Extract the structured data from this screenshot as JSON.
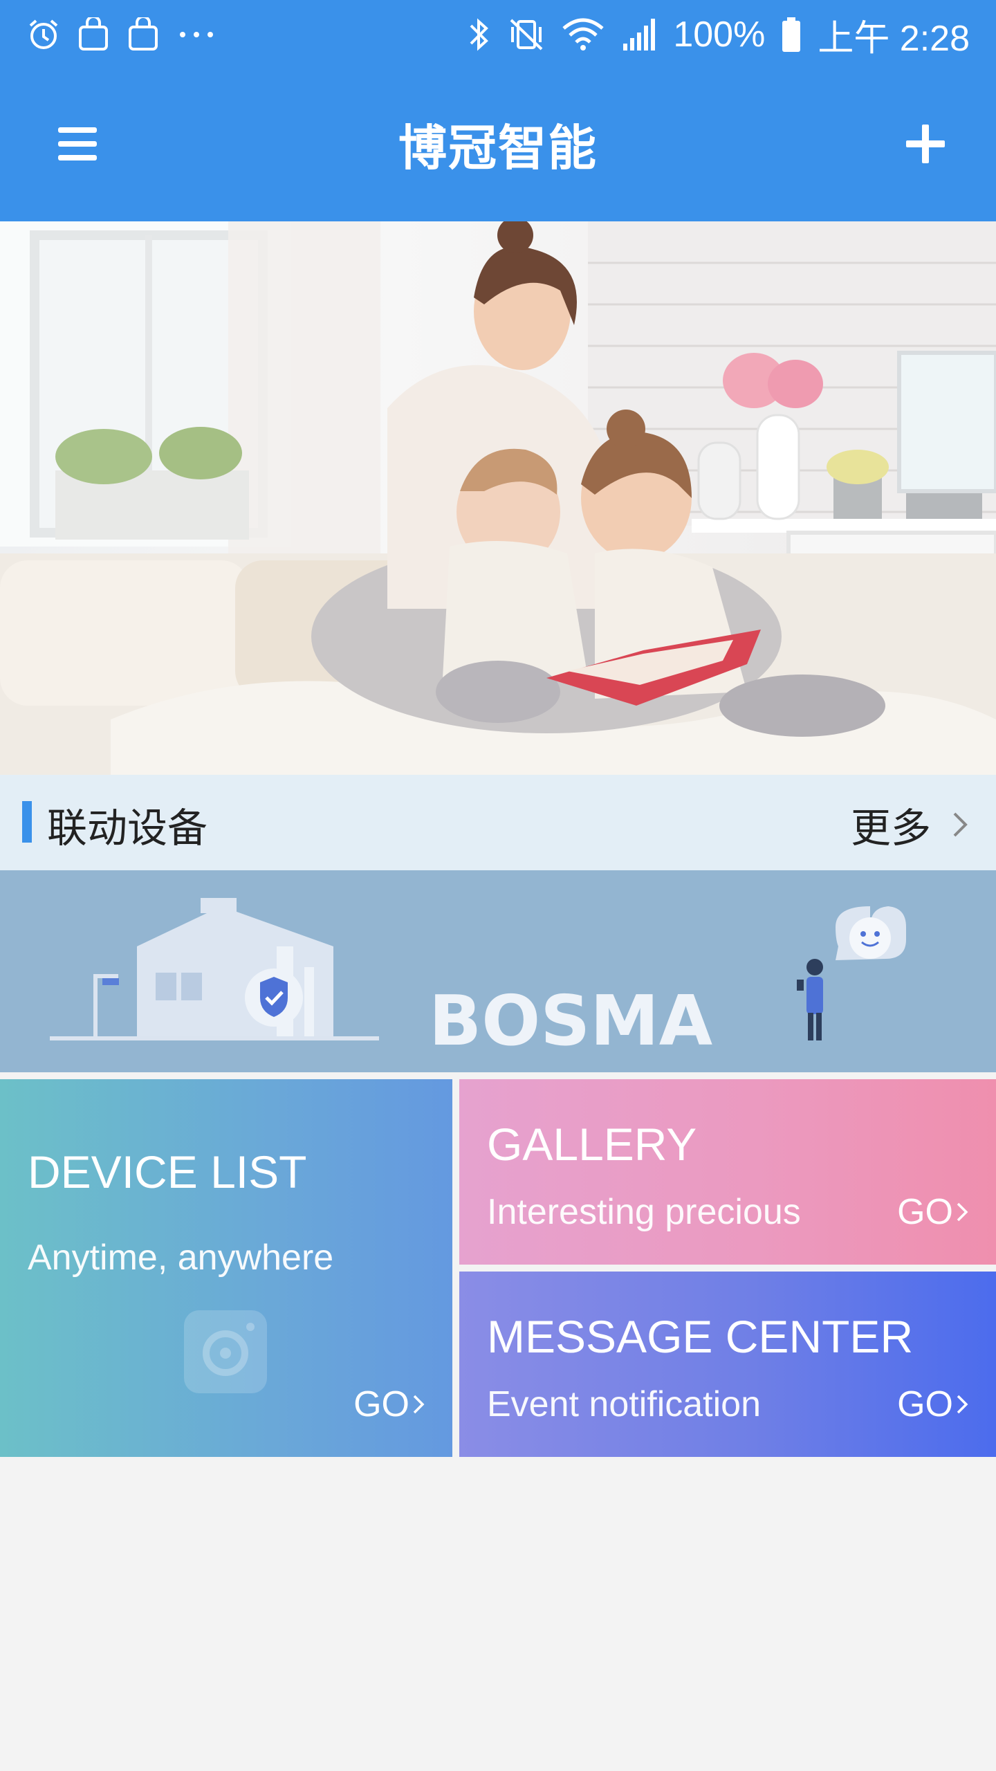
{
  "status_bar": {
    "battery_text": "100%",
    "time": "上午 2:28",
    "left_icons": [
      "alarm-icon",
      "shopping-bag-icon",
      "shopping-bag-icon",
      "more-dots-icon"
    ],
    "right_icons": [
      "bluetooth-icon",
      "vibrate-mute-icon",
      "wifi-icon",
      "signal-icon",
      "battery-icon"
    ]
  },
  "app_bar": {
    "title": "博冠智能",
    "menu_icon": "hamburger-menu-icon",
    "add_icon": "plus-icon",
    "color": "#3a91ea"
  },
  "hero": {
    "image": "family-reading-photo"
  },
  "section": {
    "title": "联动设备",
    "more_label": "更多",
    "accent": "#3a91ea"
  },
  "banner": {
    "brand": "BOSMA"
  },
  "tiles": {
    "device_list": {
      "title": "DEVICE LIST",
      "subtitle": "Anytime, anywhere",
      "go": "GO"
    },
    "gallery": {
      "title": "GALLERY",
      "subtitle": "Interesting precious",
      "go": "GO"
    },
    "message_center": {
      "title": "MESSAGE CENTER",
      "subtitle": "Event notification",
      "go": "GO"
    }
  }
}
